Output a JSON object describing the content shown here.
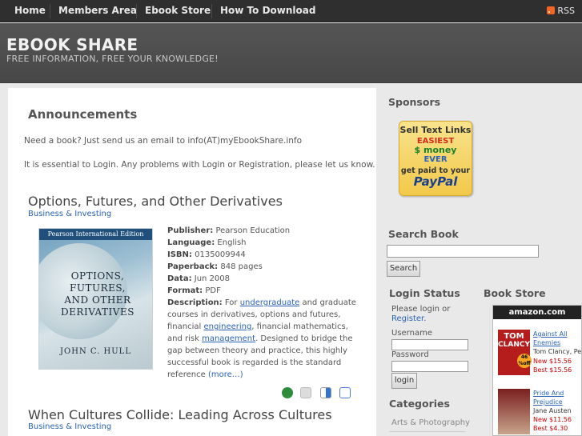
{
  "nav": {
    "items": [
      {
        "label": "Home"
      },
      {
        "label": "Members Area"
      },
      {
        "label": "Ebook Store"
      },
      {
        "label": "How To Download"
      }
    ],
    "rss": "RSS"
  },
  "header": {
    "title": "EBOOK SHARE",
    "tagline": "FREE INFORMATION, FREE YOUR KNOWLEDGE!"
  },
  "main": {
    "announcements_title": "Announcements",
    "announce_1": "Need a book? Just send us an email to info(AT)myEbookShare.info",
    "announce_2": "It is essential to Login. Any problems with Login or Registration, please let us know.",
    "post1": {
      "title": "Options, Futures, and Other Derivatives",
      "category": "Business & Investing",
      "cover": {
        "edition": "Pearson International Edition",
        "title_lines": [
          "OPTIONS,",
          "FUTURES,",
          "AND OTHER",
          "DERIVATIVES"
        ],
        "author": "JOHN C. HULL"
      },
      "details": {
        "publisher_label": "Publisher:",
        "publisher": "Pearson Education",
        "language_label": "Language:",
        "language": "English",
        "isbn_label": "ISBN:",
        "isbn": "0135009944",
        "paperback_label": "Paperback:",
        "paperback": "848 pages",
        "data_label": "Data:",
        "data": "Jun 2008",
        "format_label": "Format:",
        "format": "PDF",
        "description_label": "Description:",
        "desc_1": "For",
        "desc_link_1": "undergraduate",
        "desc_2": "and graduate courses in derivatives, options and futures, financial",
        "desc_link_2": "engineering",
        "desc_3": ", financial mathematics, and risk",
        "desc_link_3": "management",
        "desc_4": ". Designed to bridge the gap between theory and practice, this highly successful book is regarded is the standard reference",
        "more": "(more…)"
      },
      "share_icons": [
        "stumbleupon-icon",
        "digg-icon",
        "delicious-icon",
        "google-icon"
      ]
    },
    "post2": {
      "title": "When Cultures Collide: Leading Across Cultures",
      "category": "Business & Investing"
    }
  },
  "sidebar": {
    "sponsors_title": "Sponsors",
    "ad": {
      "line1": "Sell Text Links",
      "line2": "EASIEST",
      "line3": "$ money",
      "line4": "EVER",
      "line5": "get paid to your",
      "line6": "PayPal"
    },
    "search_title": "Search Book",
    "search_button": "Search",
    "login_title": "Login Status",
    "login_prompt": "Please login or",
    "register_link": "Register.",
    "username_label": "Username",
    "password_label": "Password",
    "login_button": "login",
    "categories_title": "Categories",
    "categories": [
      "Arts & Photography"
    ],
    "bookstore_title": "Book Store",
    "amazon": {
      "logo": "amazon.com",
      "books": [
        {
          "title_1": "Against All",
          "title_2": "Enemies",
          "author": "Tom Clancy, Pete",
          "new_price": "New $15.56",
          "best_price": "Best $15.56",
          "cover_text_1": "TOM",
          "cover_text_2": "CLANCY",
          "badge": "46 %off"
        },
        {
          "title_1": "Pride And",
          "title_2": "Prejudice",
          "author": "Jane Austen",
          "new_price": "New $11.56",
          "best_price": "Best $4.30"
        }
      ]
    }
  },
  "colors": {
    "nav_bg": "#2f2f2f",
    "header_bg": "#4d4d4d",
    "link": "#2a62b7",
    "page_bg": "#e9e9e9"
  }
}
